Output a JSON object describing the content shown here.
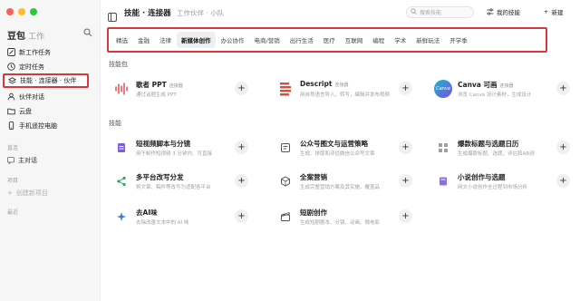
{
  "sidebar": {
    "brand": "豆包",
    "brand_sub": "工作",
    "items": [
      {
        "label": "新工作任务"
      },
      {
        "label": "定时任务"
      },
      {
        "label": "技能 · 连接器 · 伙伴"
      },
      {
        "label": "伙伴对话"
      },
      {
        "label": "云盘"
      },
      {
        "label": "手机遥控电脑"
      }
    ],
    "section_recent": "直连",
    "recent_item": "主对话",
    "section_project": "项目",
    "new_project": "创建新项目",
    "section_history": "最近"
  },
  "topbar": {
    "title": "技能 · 连接器",
    "crumb": "工作伙伴 · 小队",
    "search_placeholder": "搜索技能",
    "my_skills": "我的技能",
    "new": "新建"
  },
  "tabs": [
    "精选",
    "金融",
    "法律",
    "新媒体创作",
    "办公协作",
    "电商/营销",
    "出行生活",
    "医疗",
    "互联网",
    "编程",
    "学术",
    "新鲜玩法",
    "开学季"
  ],
  "active_tab": "新媒体创作",
  "connectors_heading": "技能包",
  "skills_heading": "技能",
  "connectors": [
    {
      "title": "歌者 PPT",
      "tag": "连接器",
      "desc": "通过话题生成 PPT",
      "icon": "waveform-icon"
    },
    {
      "title": "Descript",
      "tag": "连接器",
      "desc": "用自然语言导入，转写，编辑并发布视频",
      "icon": "descript-icon"
    },
    {
      "title": "Canva 可画",
      "tag": "连接器",
      "desc": "浏览 Canva 设计素材，生成设计",
      "icon": "canva-icon"
    }
  ],
  "skills": [
    {
      "title": "短视频脚本与分镜",
      "desc": "用于制作短视频 3 分钟内、可直接",
      "icon": "doc-icon"
    },
    {
      "title": "公众号图文与运营策略",
      "desc": "生成、排版和评估微信公众号文章",
      "icon": "list-icon"
    },
    {
      "title": "爆款标题与选题日历",
      "desc": "生成爆款标题、选题，评估和AB测",
      "icon": "grid-icon"
    },
    {
      "title": "多平台改写分发",
      "desc": "将文章、稿件等改写为适配各平台",
      "icon": "share-icon"
    },
    {
      "title": "全案营销",
      "desc": "生成完整营销方案及其实施，覆盖品",
      "icon": "cube-icon"
    },
    {
      "title": "小说创作与选题",
      "desc": "网文小说创作全过程到市场分析",
      "icon": "book-icon"
    },
    {
      "title": "去AI味",
      "desc": "去除改善文本中的 AI 味",
      "icon": "sparkle-icon"
    },
    {
      "title": "短剧创作",
      "desc": "生成短剧剧本、分镜、动画、微电影",
      "icon": "clapper-icon"
    }
  ],
  "colors": {
    "accent_red": "#d9383a",
    "purple": "#7c5ce0",
    "green": "#2aa86a",
    "blue": "#3a7bd5"
  }
}
